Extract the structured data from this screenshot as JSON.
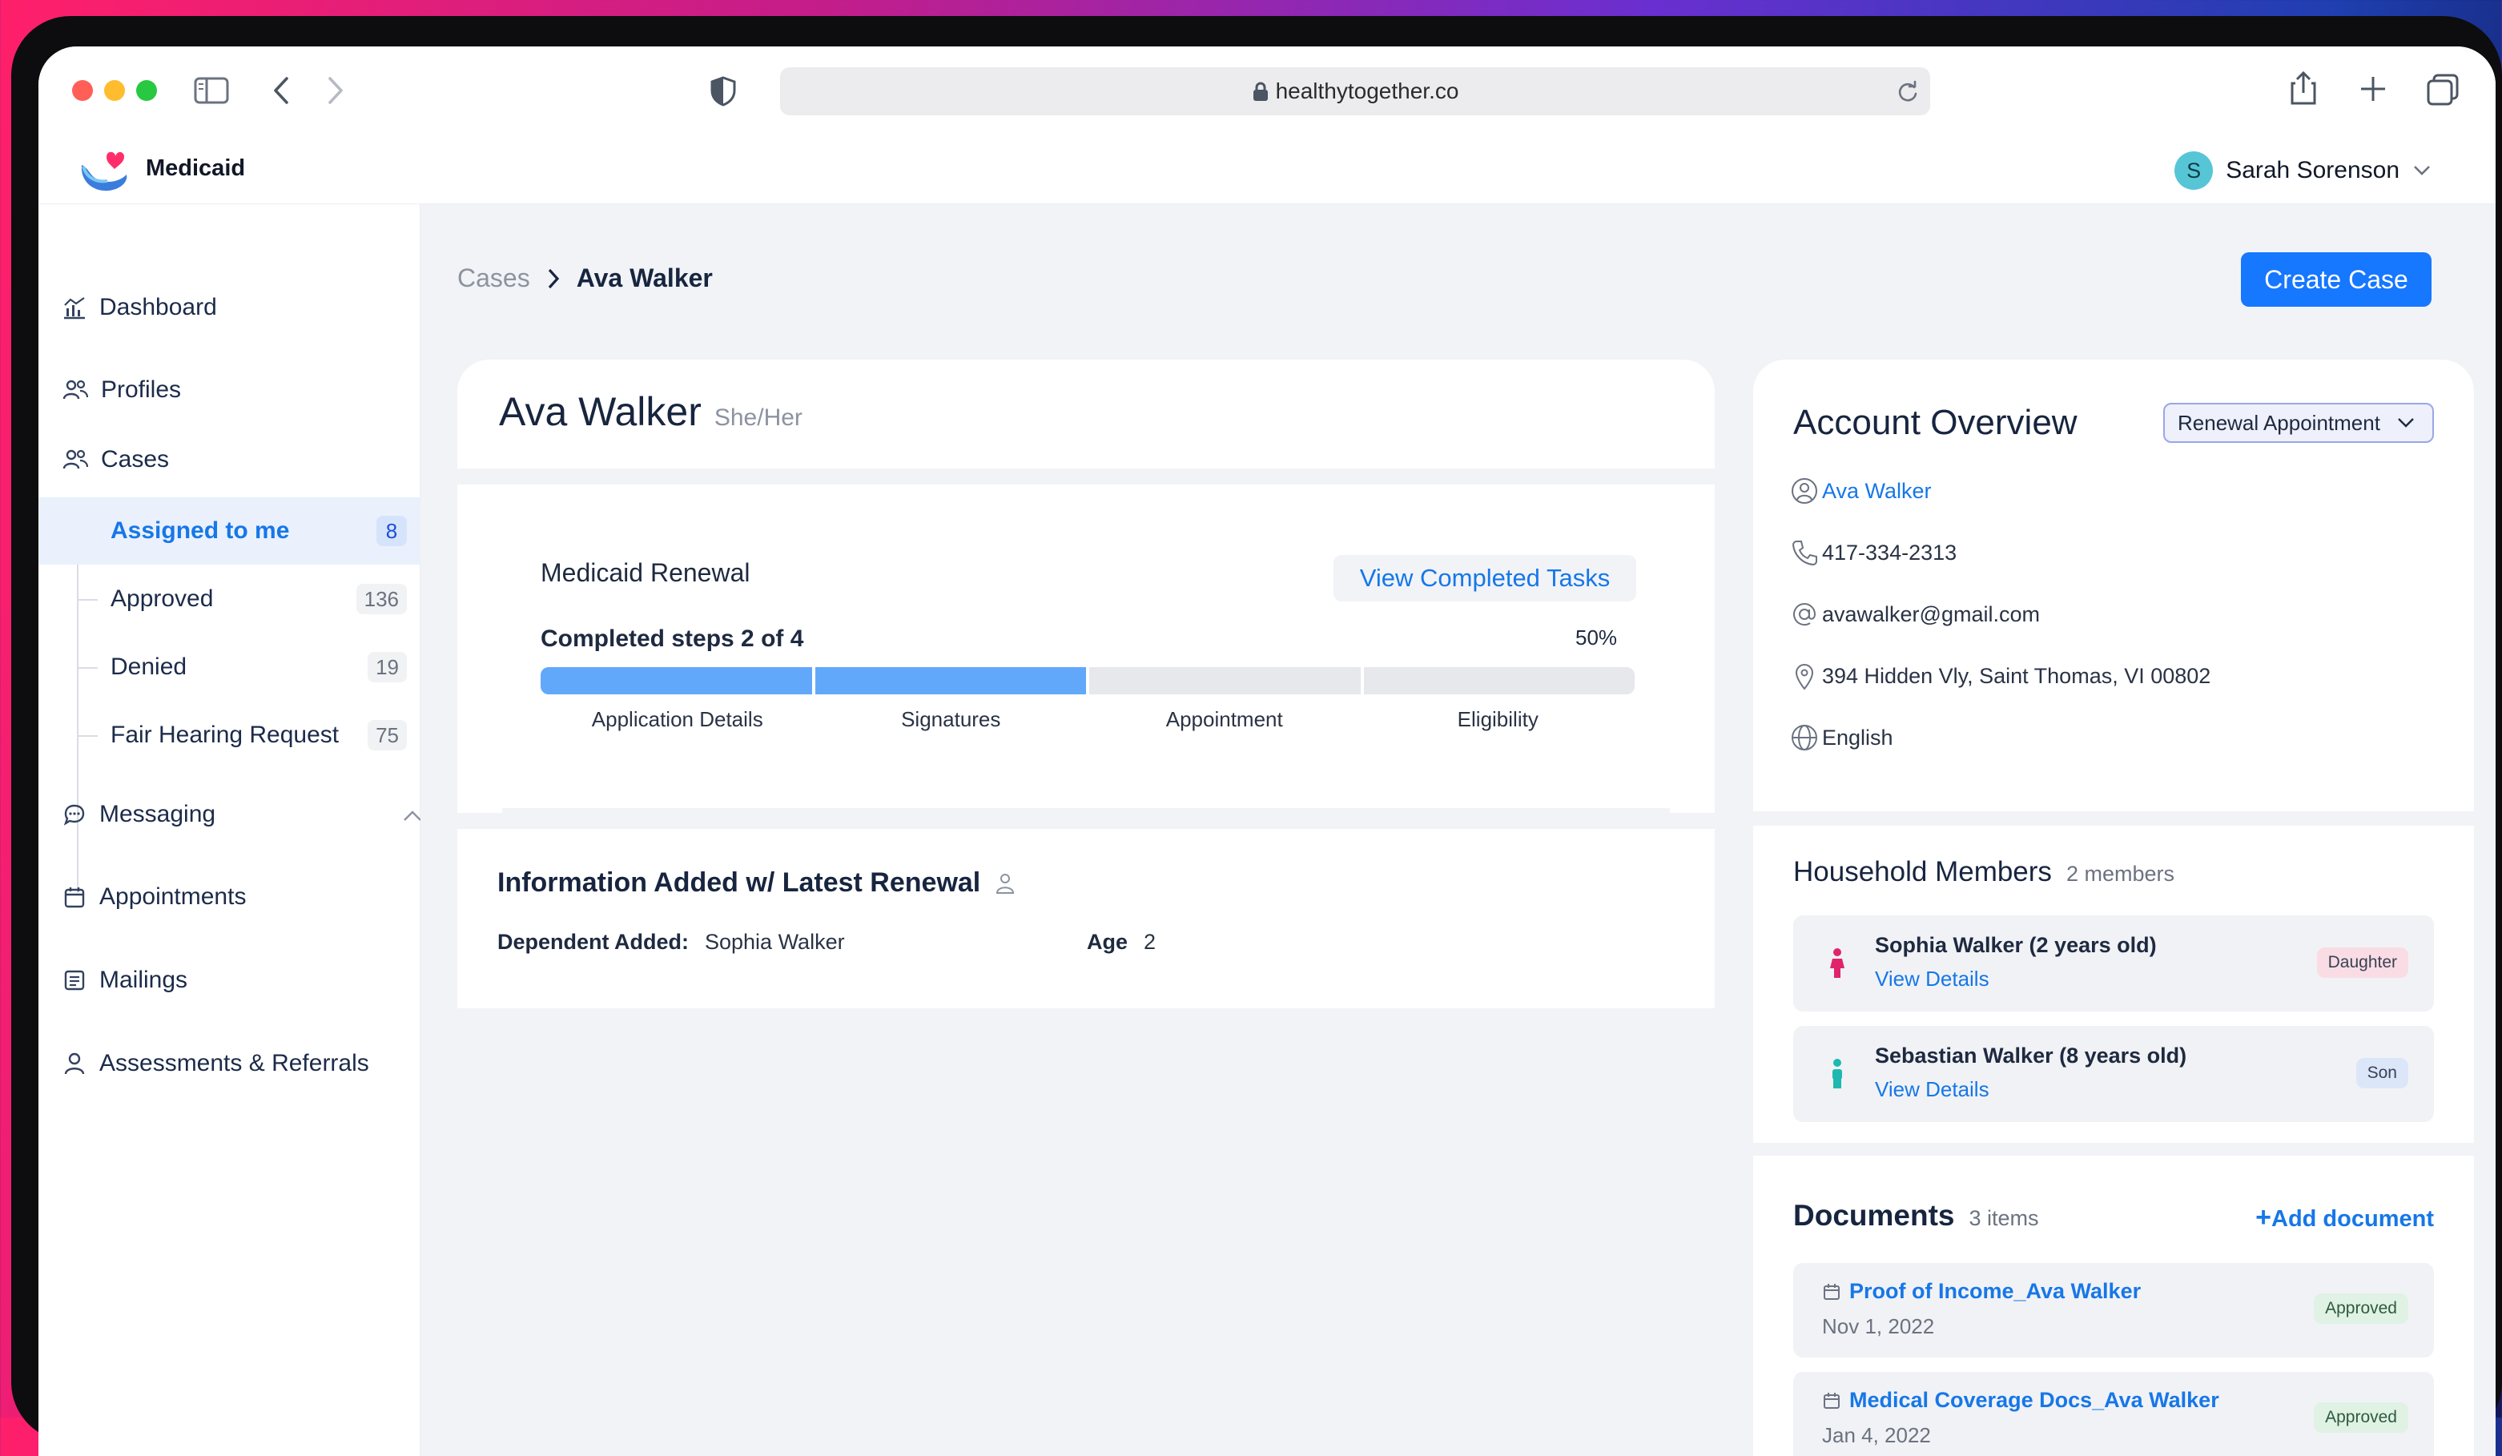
{
  "browser": {
    "url": "healthytogether.co"
  },
  "app": {
    "brand": "Medicaid",
    "user_initial": "S",
    "user_name": "Sarah Sorenson"
  },
  "sidebar": {
    "dashboard": "Dashboard",
    "profiles": "Profiles",
    "cases": "Cases",
    "sub": [
      {
        "label": "Assigned to me",
        "count": "8"
      },
      {
        "label": "Approved",
        "count": "136"
      },
      {
        "label": "Denied",
        "count": "19"
      },
      {
        "label": "Fair Hearing Request",
        "count": "75"
      }
    ],
    "messaging": "Messaging",
    "appointments": "Appointments",
    "mailings": "Mailings",
    "assessments": "Assessments & Referrals"
  },
  "breadcrumb": {
    "parent": "Cases",
    "current": "Ava Walker"
  },
  "create_case": "Create Case",
  "profile": {
    "name": "Ava Walker",
    "pronouns": "She/Her"
  },
  "renewal": {
    "title": "Medicaid Renewal",
    "view_completed": "View Completed Tasks",
    "steps_label": "Completed steps 2 of 4",
    "percent_label": "50%",
    "progress_fraction": 0.5,
    "steps": [
      "Application Details",
      "Signatures",
      "Appointment",
      "Eligibility"
    ]
  },
  "info": {
    "title": "Information Added w/ Latest Renewal",
    "dependent_label": "Dependent Added:",
    "dependent_value": "Sophia Walker",
    "age_label": "Age",
    "age_value": "2"
  },
  "overview": {
    "title": "Account Overview",
    "dropdown": "Renewal Appointment",
    "name": "Ava Walker",
    "phone": "417-334-2313",
    "email": "avawalker@gmail.com",
    "address": "394 Hidden Vly, Saint Thomas, VI 00802",
    "language": "English"
  },
  "household": {
    "title": "Household Members",
    "count": "2 members",
    "members": [
      {
        "name": "Sophia Walker (2 years old)",
        "link": "View Details",
        "relation": "Daughter"
      },
      {
        "name": "Sebastian Walker (8 years old)",
        "link": "View Details",
        "relation": "Son"
      }
    ]
  },
  "documents": {
    "title": "Documents",
    "count": "3 items",
    "add_label": "Add document",
    "items": [
      {
        "name": "Proof of Income_Ava Walker",
        "date": "Nov 1, 2022",
        "status": "Approved"
      },
      {
        "name": "Medical Coverage Docs_Ava Walker",
        "date": "Jan 4, 2022",
        "status": "Approved"
      }
    ]
  },
  "colors": {
    "accent": "#1677ff",
    "progress_done": "#62a8fa",
    "daughter_icon": "#e0246b",
    "son_icon": "#1fb8b0"
  }
}
